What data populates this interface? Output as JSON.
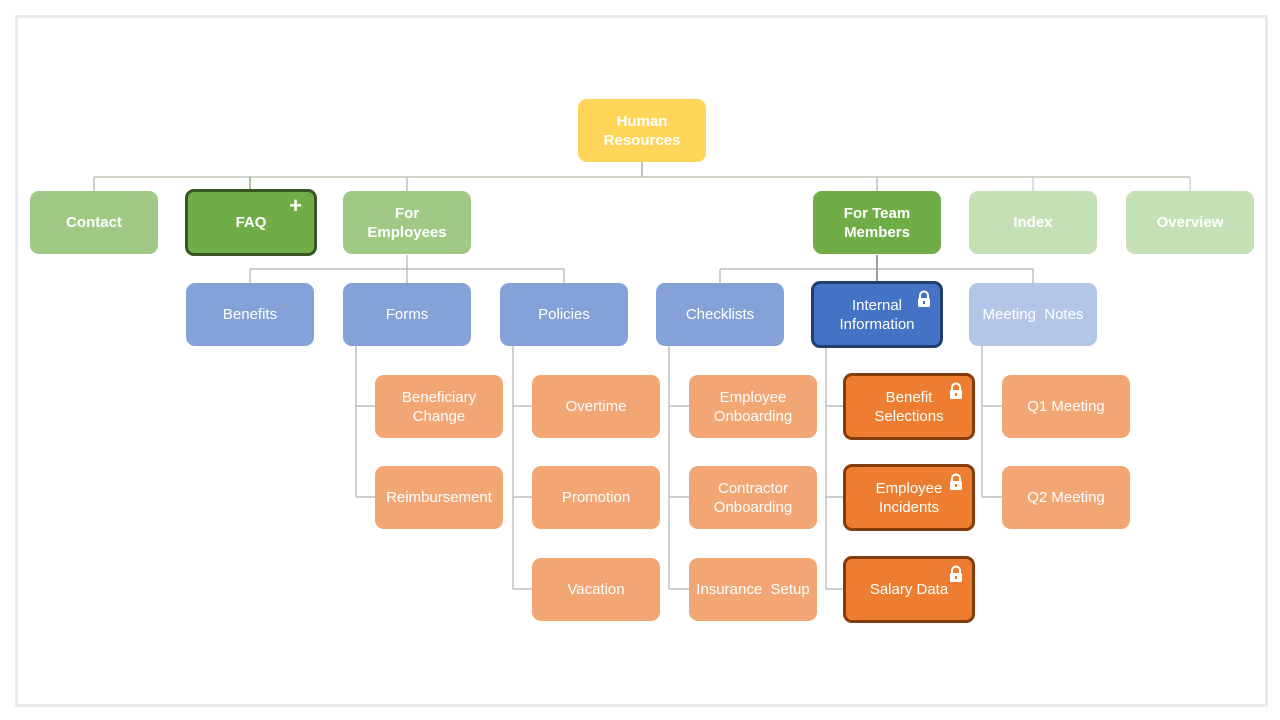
{
  "diagram": {
    "type": "org-chart",
    "root": {
      "id": "hr",
      "label": "Human\nResources"
    },
    "level1": [
      {
        "id": "contact",
        "label": "Contact"
      },
      {
        "id": "faq",
        "label": "FAQ",
        "icon": "plus-icon",
        "selected": true
      },
      {
        "id": "for-employees",
        "label": "For\nEmployees"
      },
      {
        "id": "for-team-members",
        "label": "For Team\nMembers"
      },
      {
        "id": "index",
        "label": "Index"
      },
      {
        "id": "overview",
        "label": "Overview"
      }
    ],
    "level2": [
      {
        "id": "benefits",
        "label": "Benefits",
        "parent": "for-employees"
      },
      {
        "id": "forms",
        "label": "Forms",
        "parent": "for-employees"
      },
      {
        "id": "policies",
        "label": "Policies",
        "parent": "for-employees"
      },
      {
        "id": "checklists",
        "label": "Checklists",
        "parent": "for-team-members"
      },
      {
        "id": "internal-information",
        "label": "Internal\nInformation",
        "parent": "for-team-members",
        "icon": "lock-icon",
        "selected": true
      },
      {
        "id": "meeting-notes",
        "label": "Meeting  Notes",
        "parent": "for-team-members"
      }
    ],
    "level3": [
      {
        "id": "beneficiary-change",
        "label": "Beneficiary\nChange",
        "parent": "forms"
      },
      {
        "id": "reimbursement",
        "label": "Reimbursement",
        "parent": "forms"
      },
      {
        "id": "overtime",
        "label": "Overtime",
        "parent": "policies"
      },
      {
        "id": "promotion",
        "label": "Promotion",
        "parent": "policies"
      },
      {
        "id": "vacation",
        "label": "Vacation",
        "parent": "policies"
      },
      {
        "id": "employee-onboarding",
        "label": "Employee\nOnboarding",
        "parent": "checklists"
      },
      {
        "id": "contractor-onboarding",
        "label": "Contractor\nOnboarding",
        "parent": "checklists"
      },
      {
        "id": "insurance-setup",
        "label": "Insurance  Setup",
        "parent": "checklists"
      },
      {
        "id": "benefit-selections",
        "label": "Benefit\nSelections",
        "parent": "internal-information",
        "icon": "lock-icon",
        "selected": true
      },
      {
        "id": "employee-incidents",
        "label": "Employee\nIncidents",
        "parent": "internal-information",
        "icon": "lock-icon",
        "selected": true
      },
      {
        "id": "salary-data",
        "label": "Salary Data",
        "parent": "internal-information",
        "icon": "lock-icon",
        "selected": true
      },
      {
        "id": "q1-meeting",
        "label": "Q1 Meeting",
        "parent": "meeting-notes"
      },
      {
        "id": "q2-meeting",
        "label": "Q2 Meeting",
        "parent": "meeting-notes"
      }
    ]
  },
  "colors": {
    "root": "#ffd55a",
    "green": "#a0c985",
    "green_dark": "#70ad47",
    "green_light": "#c5e0b4",
    "blue": "#85a2d8",
    "blue_dark": "#4472c4",
    "blue_light": "#b4c6e7",
    "orange_light": "#f2a673",
    "orange": "#ed7d31",
    "connector": "#bfbfbf"
  }
}
